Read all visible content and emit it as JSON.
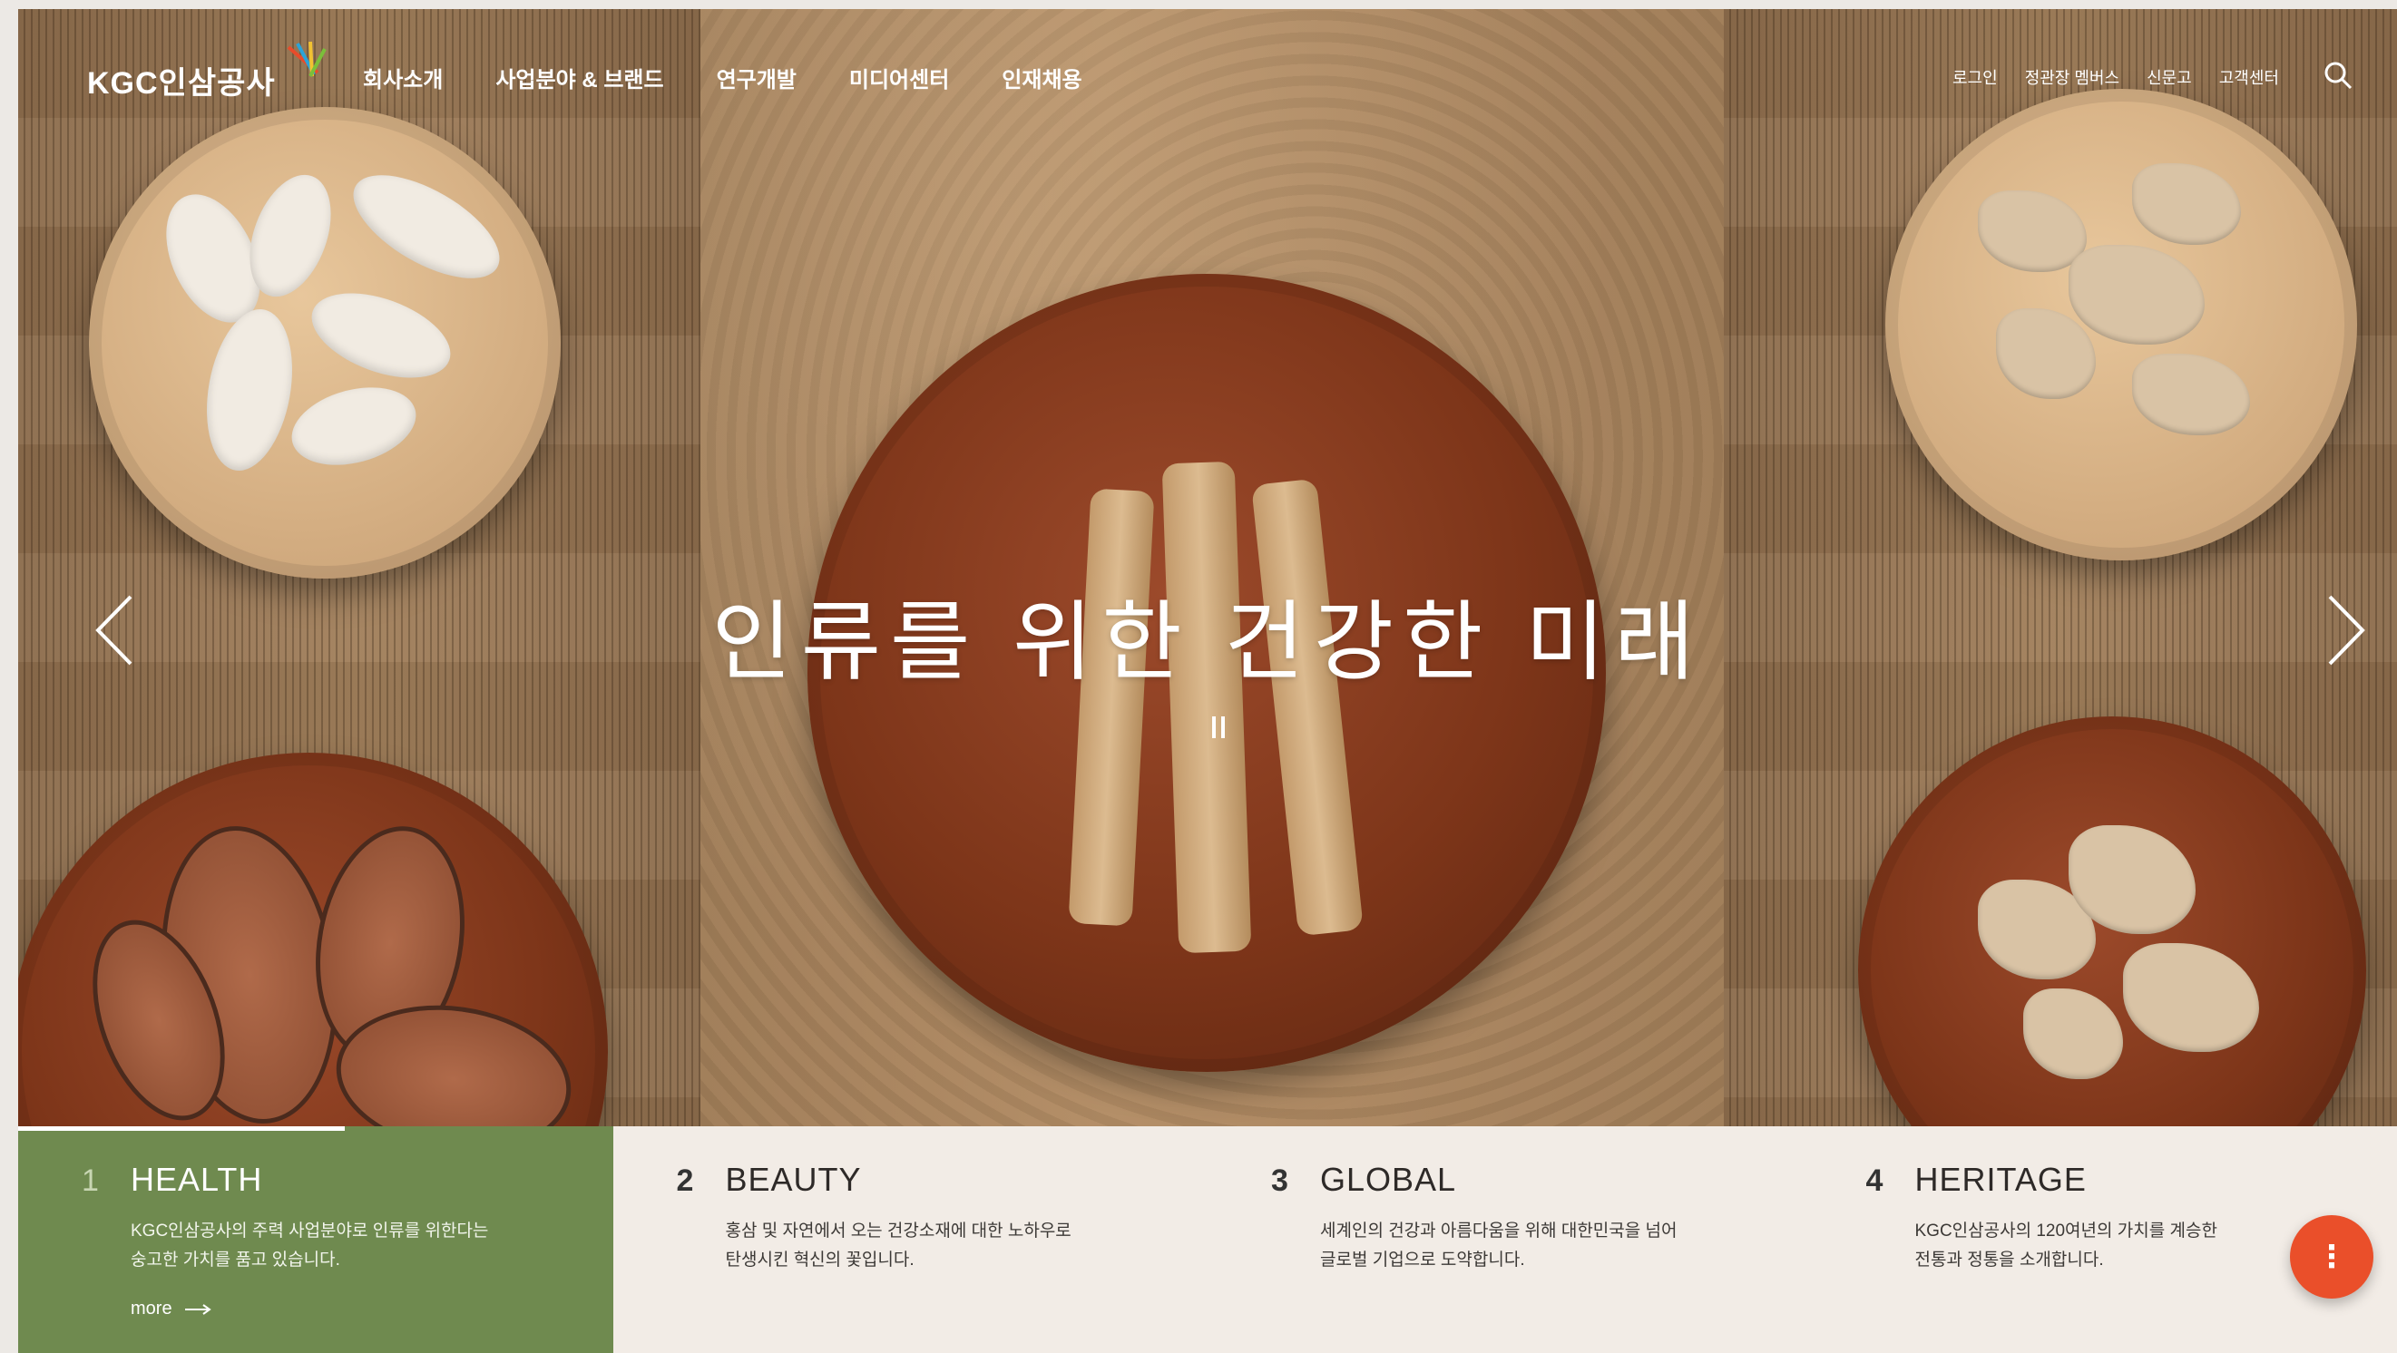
{
  "header": {
    "logo": "KGC인삼공사",
    "gnb": [
      "회사소개",
      "사업분야 & 브랜드",
      "연구개발",
      "미디어센터",
      "인재채용"
    ],
    "util": [
      "로그인",
      "정관장 멤버스",
      "신문고",
      "고객센터"
    ],
    "search_icon": "search-icon"
  },
  "hero": {
    "title": "인류를 위한 건강한 미래",
    "prev_icon": "chevron-left-icon",
    "next_icon": "chevron-right-icon",
    "pause_icon": "pause-icon"
  },
  "cards": [
    {
      "num": "1",
      "title": "HEALTH",
      "desc1": "KGC인삼공사의 주력 사업분야로 인류를 위한다는",
      "desc2": "숭고한 가치를 품고 있습니다.",
      "more": "more"
    },
    {
      "num": "2",
      "title": "BEAUTY",
      "desc1": "홍삼 및 자연에서 오는 건강소재에 대한 노하우로",
      "desc2": "탄생시킨 혁신의 꽃입니다."
    },
    {
      "num": "3",
      "title": "GLOBAL",
      "desc1": "세계인의 건강과 아름다움을 위해 대한민국을 넘어",
      "desc2": "글로벌 기업으로 도약합니다."
    },
    {
      "num": "4",
      "title": "HERITAGE",
      "desc1": "KGC인삼공사의 120여년의 가치를 계승한",
      "desc2": "전통과 정통을 소개합니다."
    }
  ],
  "fab_label": "⋮",
  "colors": {
    "active_card": "#6f8a4f",
    "fab": "#ea4f2a"
  }
}
